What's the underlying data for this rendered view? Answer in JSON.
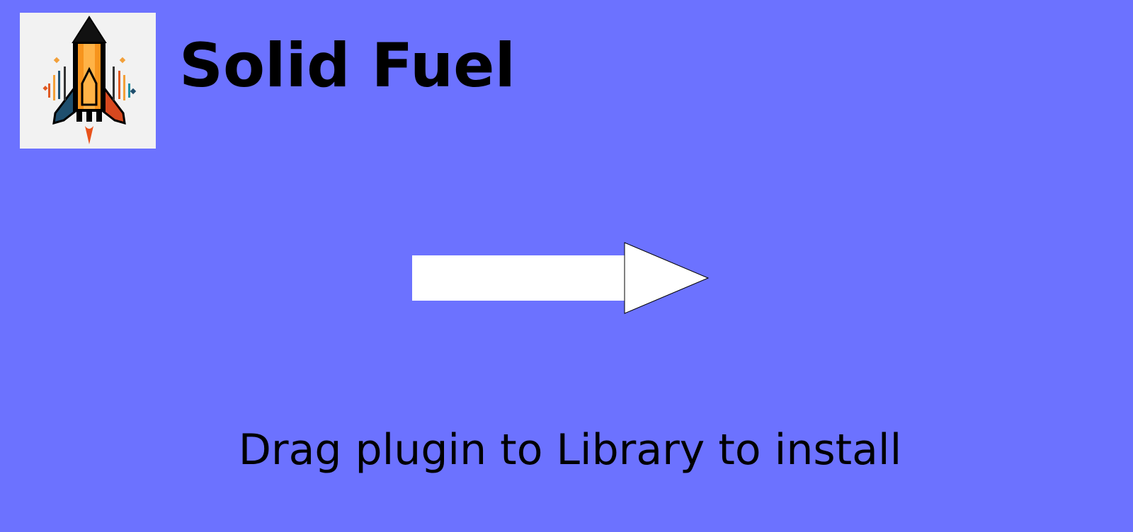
{
  "window": {
    "background_color": "#6c72ff"
  },
  "header": {
    "app_name": "Solid Fuel",
    "icon": "solid-fuel-rocket-icon"
  },
  "main": {
    "arrow_icon": "right-arrow-icon",
    "instruction": "Drag plugin to Library to install"
  },
  "colors": {
    "text": "#000000",
    "arrow_fill": "#ffffff",
    "icon_background": "#f2f2f2"
  }
}
